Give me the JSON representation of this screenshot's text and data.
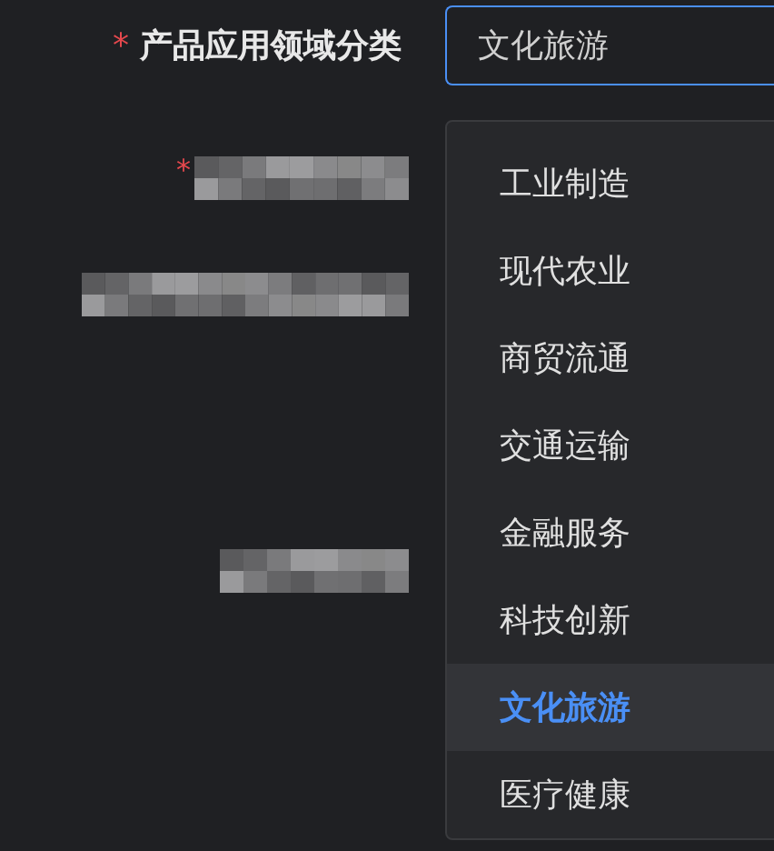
{
  "field": {
    "required_mark": "*",
    "label": "产品应用领域分类",
    "value": "文化旅游",
    "focused": true
  },
  "hidden_fields": [
    {
      "kind": "required",
      "required_mark": "*"
    },
    {
      "kind": "plain"
    },
    {
      "kind": "plain"
    }
  ],
  "dropdown": {
    "options": [
      {
        "label": "工业制造",
        "selected": false
      },
      {
        "label": "现代农业",
        "selected": false
      },
      {
        "label": "商贸流通",
        "selected": false
      },
      {
        "label": "交通运输",
        "selected": false
      },
      {
        "label": "金融服务",
        "selected": false
      },
      {
        "label": "科技创新",
        "selected": false
      },
      {
        "label": "文化旅游",
        "selected": true
      },
      {
        "label": "医疗健康",
        "selected": false
      }
    ]
  }
}
